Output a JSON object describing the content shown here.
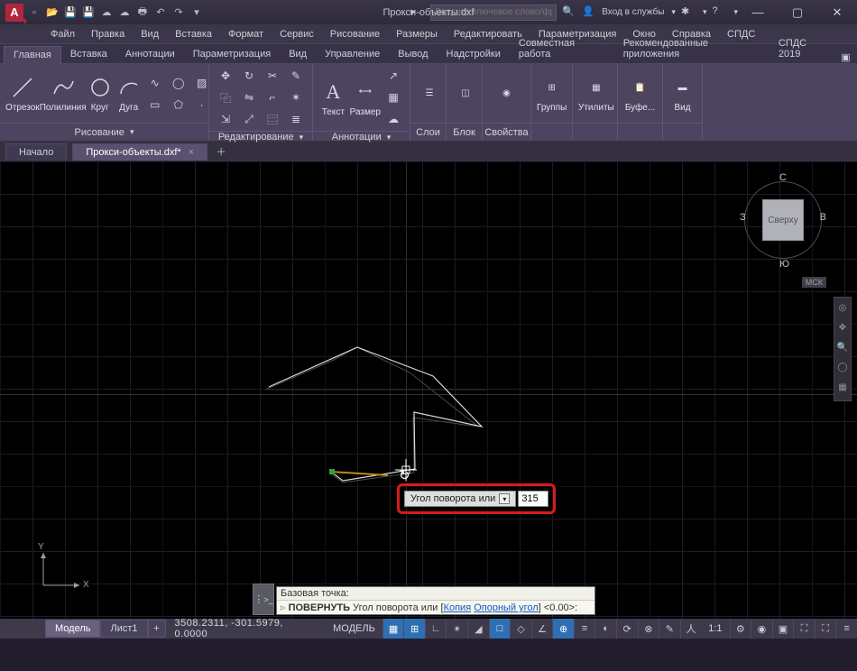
{
  "titlebar": {
    "document_title": "Прокси-объекты.dxf",
    "search_placeholder": "Введите ключевое слово/фразу",
    "login_label": "Вход в службы"
  },
  "menubar": [
    "Файл",
    "Правка",
    "Вид",
    "Вставка",
    "Формат",
    "Сервис",
    "Рисование",
    "Размеры",
    "Редактировать",
    "Параметризация",
    "Окно",
    "Справка",
    "СПДС"
  ],
  "ribbon_tabs": [
    "Главная",
    "Вставка",
    "Аннотации",
    "Параметризация",
    "Вид",
    "Управление",
    "Вывод",
    "Надстройки",
    "Совместная работа",
    "Рекомендованные приложения",
    "СПДС 2019"
  ],
  "ribbon_active_tab": 0,
  "panels": {
    "draw": {
      "title": "Рисование",
      "line": "Отрезок",
      "polyline": "Полилиния",
      "circle": "Круг",
      "arc": "Дуга"
    },
    "modify": {
      "title": "Редактирование"
    },
    "annotation": {
      "title": "Аннотации",
      "text": "Текст",
      "dim": "Размер"
    },
    "layers": {
      "title": "Слои"
    },
    "block": {
      "title": "Блок"
    },
    "properties": {
      "title": "Свойства"
    },
    "groups": {
      "title": "Группы"
    },
    "utilities": {
      "title": "Утилиты"
    },
    "clipboard": {
      "title": "Буфе..."
    },
    "view": {
      "title": "Вид"
    }
  },
  "file_tabs": {
    "start": "Начало",
    "current": "Прокси-объекты.dxf*"
  },
  "viewcube": {
    "top": "Сверху",
    "n": "С",
    "s": "Ю",
    "w": "З",
    "e": "В",
    "cs": "МСК"
  },
  "dynamic_input": {
    "label": "Угол поворота или",
    "value": "315"
  },
  "command_line": {
    "history": "Базовая точка:",
    "icon": ">_",
    "current_cmd": "ПОВЕРНУТЬ",
    "current_text": " Угол поворота или [",
    "opt1": "Копия",
    "sep": " ",
    "opt2": "Опорный угол",
    "tail": "] <0.00>:"
  },
  "status": {
    "tab_model": "Модель",
    "tab_sheet1": "Лист1",
    "coords": "3508.2311, -301.5979, 0.0000",
    "mode": "МОДЕЛЬ",
    "scale": "1:1"
  },
  "ucs": {
    "x": "X",
    "y": "Y"
  }
}
